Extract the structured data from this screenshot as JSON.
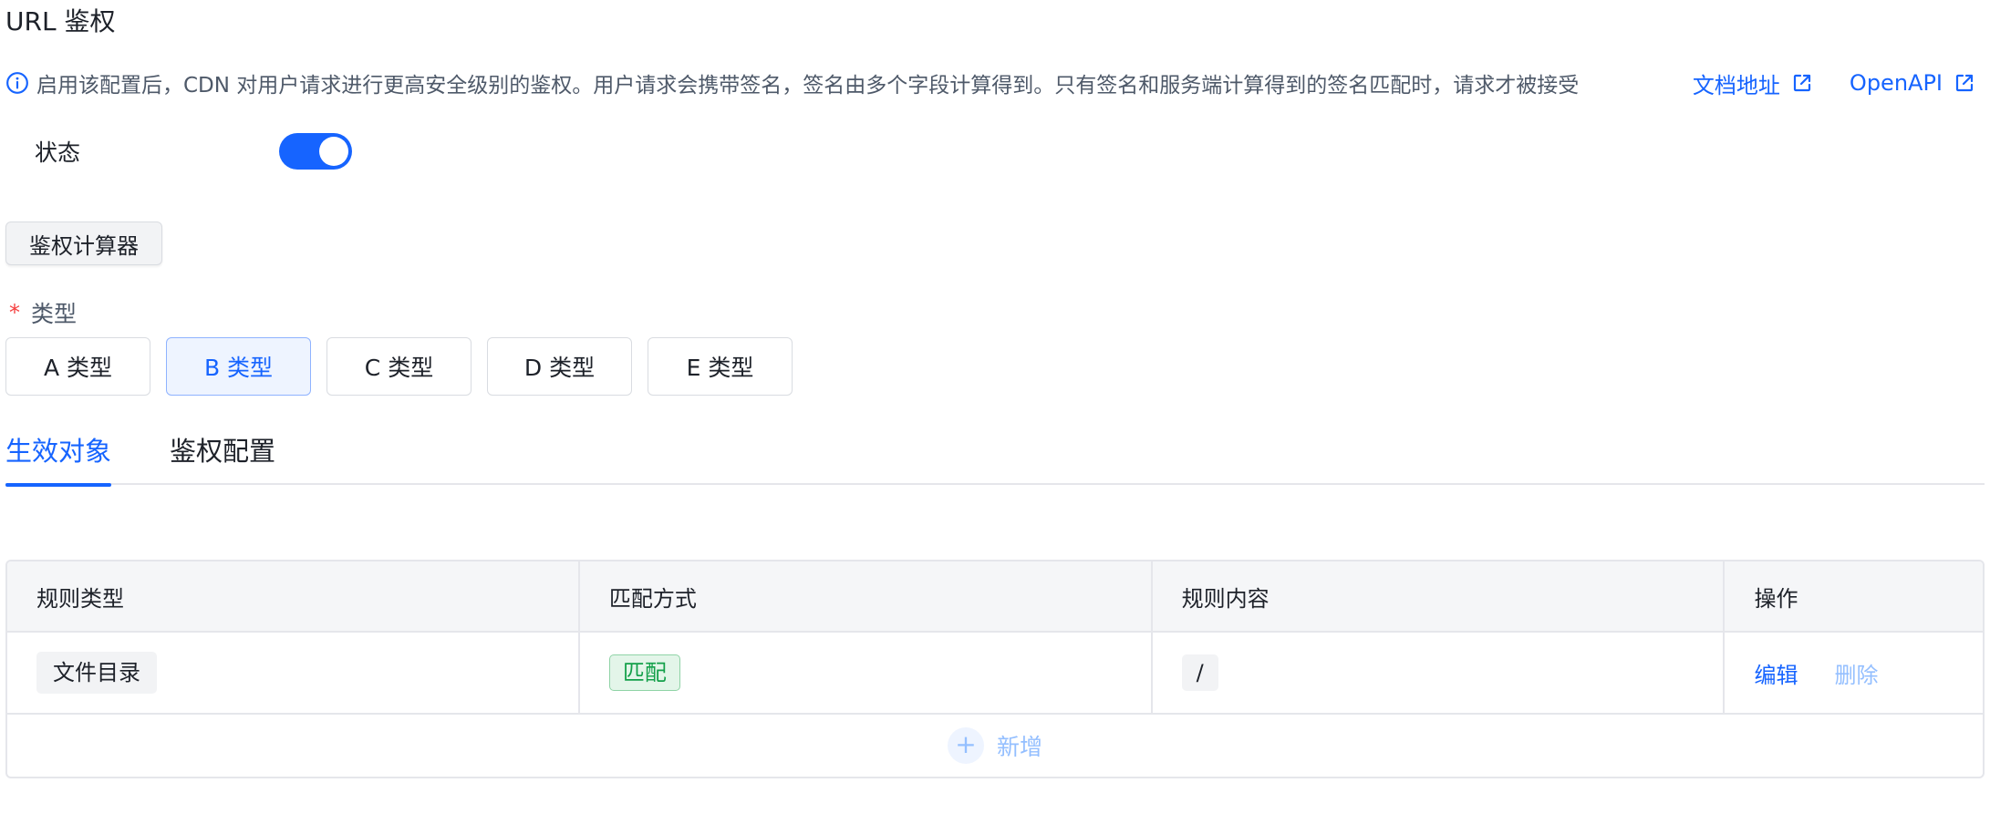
{
  "page": {
    "title": "URL 鉴权"
  },
  "notice": {
    "text": "启用该配置后，CDN 对用户请求进行更高安全级别的鉴权。用户请求会携带签名，签名由多个字段计算得到。只有签名和服务端计算得到的签名匹配时，请求才被接受",
    "doc_link": "文档地址",
    "api_link": "OpenAPI"
  },
  "status": {
    "label": "状态",
    "enabled": true
  },
  "calculator": {
    "label": "鉴权计算器"
  },
  "type_field": {
    "required_mark": "*",
    "label": "类型",
    "options": [
      "A 类型",
      "B 类型",
      "C 类型",
      "D 类型",
      "E 类型"
    ],
    "selected": "B 类型"
  },
  "tabs": [
    {
      "label": "生效对象",
      "active": true
    },
    {
      "label": "鉴权配置",
      "active": false
    }
  ],
  "table": {
    "columns": [
      "规则类型",
      "匹配方式",
      "规则内容",
      "操作"
    ],
    "rows": [
      {
        "rule_type": "文件目录",
        "match": "匹配",
        "content": "/",
        "edit": "编辑",
        "delete": "删除"
      }
    ],
    "add_label": "新增"
  },
  "colors": {
    "primary": "#1664ff",
    "success": "#14a04a",
    "danger": "#f53f3f"
  }
}
